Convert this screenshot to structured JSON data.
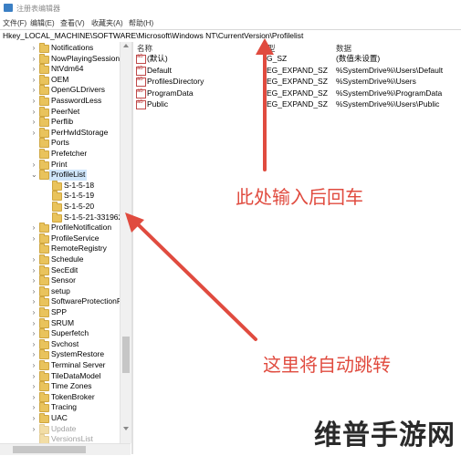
{
  "window": {
    "title": "注册表编辑器"
  },
  "menu": [
    "文件(F)",
    "编辑(E)",
    "查看(V)",
    "收藏夹(A)",
    "帮助(H)"
  ],
  "address": "Hkey_LOCAL_MACHINE\\SOFTWARE\\Microsoft\\Windows NT\\CurrentVersion\\Profilelist",
  "tree": [
    {
      "label": "Notifications",
      "level": 0,
      "expander": ">"
    },
    {
      "label": "NowPlayingSessionI",
      "level": 0,
      "expander": ">"
    },
    {
      "label": "NtVdm64",
      "level": 0,
      "expander": ">"
    },
    {
      "label": "OEM",
      "level": 0,
      "expander": ">"
    },
    {
      "label": "OpenGLDrivers",
      "level": 0,
      "expander": ">"
    },
    {
      "label": "PasswordLess",
      "level": 0,
      "expander": ">"
    },
    {
      "label": "PeerNet",
      "level": 0,
      "expander": ">"
    },
    {
      "label": "Perflib",
      "level": 0,
      "expander": ">"
    },
    {
      "label": "PerHwIdStorage",
      "level": 0,
      "expander": ">"
    },
    {
      "label": "Ports",
      "level": 0,
      "expander": ""
    },
    {
      "label": "Prefetcher",
      "level": 0,
      "expander": ""
    },
    {
      "label": "Print",
      "level": 0,
      "expander": ">"
    },
    {
      "label": "ProfileList",
      "level": 0,
      "expander": "v",
      "selected": true
    },
    {
      "label": "S-1-5-18",
      "level": 1,
      "expander": ""
    },
    {
      "label": "S-1-5-19",
      "level": 1,
      "expander": ""
    },
    {
      "label": "S-1-5-20",
      "level": 1,
      "expander": ""
    },
    {
      "label": "S-1-5-21-331962",
      "level": 1,
      "expander": ""
    },
    {
      "label": "ProfileNotification",
      "level": 0,
      "expander": ">"
    },
    {
      "label": "ProfileService",
      "level": 0,
      "expander": ">"
    },
    {
      "label": "RemoteRegistry",
      "level": 0,
      "expander": ""
    },
    {
      "label": "Schedule",
      "level": 0,
      "expander": ">"
    },
    {
      "label": "SecEdit",
      "level": 0,
      "expander": ">"
    },
    {
      "label": "Sensor",
      "level": 0,
      "expander": ">"
    },
    {
      "label": "setup",
      "level": 0,
      "expander": ">"
    },
    {
      "label": "SoftwareProtectionF",
      "level": 0,
      "expander": ">"
    },
    {
      "label": "SPP",
      "level": 0,
      "expander": ">"
    },
    {
      "label": "SRUM",
      "level": 0,
      "expander": ">"
    },
    {
      "label": "Superfetch",
      "level": 0,
      "expander": ">"
    },
    {
      "label": "Svchost",
      "level": 0,
      "expander": ">"
    },
    {
      "label": "SystemRestore",
      "level": 0,
      "expander": ">"
    },
    {
      "label": "Terminal Server",
      "level": 0,
      "expander": ">"
    },
    {
      "label": "TileDataModel",
      "level": 0,
      "expander": ">"
    },
    {
      "label": "Time Zones",
      "level": 0,
      "expander": ">"
    },
    {
      "label": "TokenBroker",
      "level": 0,
      "expander": ">"
    },
    {
      "label": "Tracing",
      "level": 0,
      "expander": ">"
    },
    {
      "label": "UAC",
      "level": 0,
      "expander": ">"
    },
    {
      "label": "Update",
      "level": 0,
      "expander": ">",
      "dim": true
    },
    {
      "label": "VersionsList",
      "level": 0,
      "expander": "",
      "dim": true
    }
  ],
  "list": {
    "headers": [
      "名称",
      "型",
      "数据"
    ],
    "rows": [
      {
        "name": "(默认)",
        "type": "G_SZ",
        "data": "(数值未设置)"
      },
      {
        "name": "Default",
        "type": "EG_EXPAND_SZ",
        "data": "%SystemDrive%\\Users\\Default"
      },
      {
        "name": "ProfilesDirectory",
        "type": "EG_EXPAND_SZ",
        "data": "%SystemDrive%\\Users"
      },
      {
        "name": "ProgramData",
        "type": "EG_EXPAND_SZ",
        "data": "%SystemDrive%\\ProgramData"
      },
      {
        "name": "Public",
        "type": "EG_EXPAND_SZ",
        "data": "%SystemDrive%\\Users\\Public"
      }
    ]
  },
  "annotations": {
    "enter_hint": "此处输入后回车",
    "jump_hint": "这里将自动跳转"
  },
  "watermark": "维普手游网",
  "colors": {
    "annotation": "#e04b3f",
    "selection": "#cfe6fb",
    "folder": "#e9c35c"
  }
}
